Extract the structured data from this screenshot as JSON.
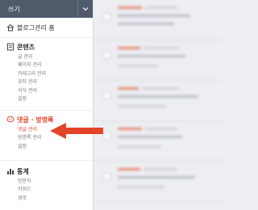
{
  "sidebar": {
    "write_label": "쓰기",
    "home": "블로그관리 홈",
    "content": {
      "title": "콘텐츠",
      "items": [
        "글 관리",
        "페이지 관리",
        "카테고리 관리",
        "공지 관리",
        "서식 관리",
        "설정"
      ]
    },
    "comments": {
      "title": "댓글 · 방명록",
      "items": [
        "댓글 관리",
        "방명록 관리",
        "설정"
      ],
      "active_item": "댓글 관리"
    },
    "stats": {
      "title": "통계",
      "items": [
        "방문자",
        "키워드",
        "경로"
      ]
    }
  },
  "colors": {
    "accent": "#e2442a",
    "write_bar": "#4f5a6b",
    "arrow": "#e2442a"
  }
}
